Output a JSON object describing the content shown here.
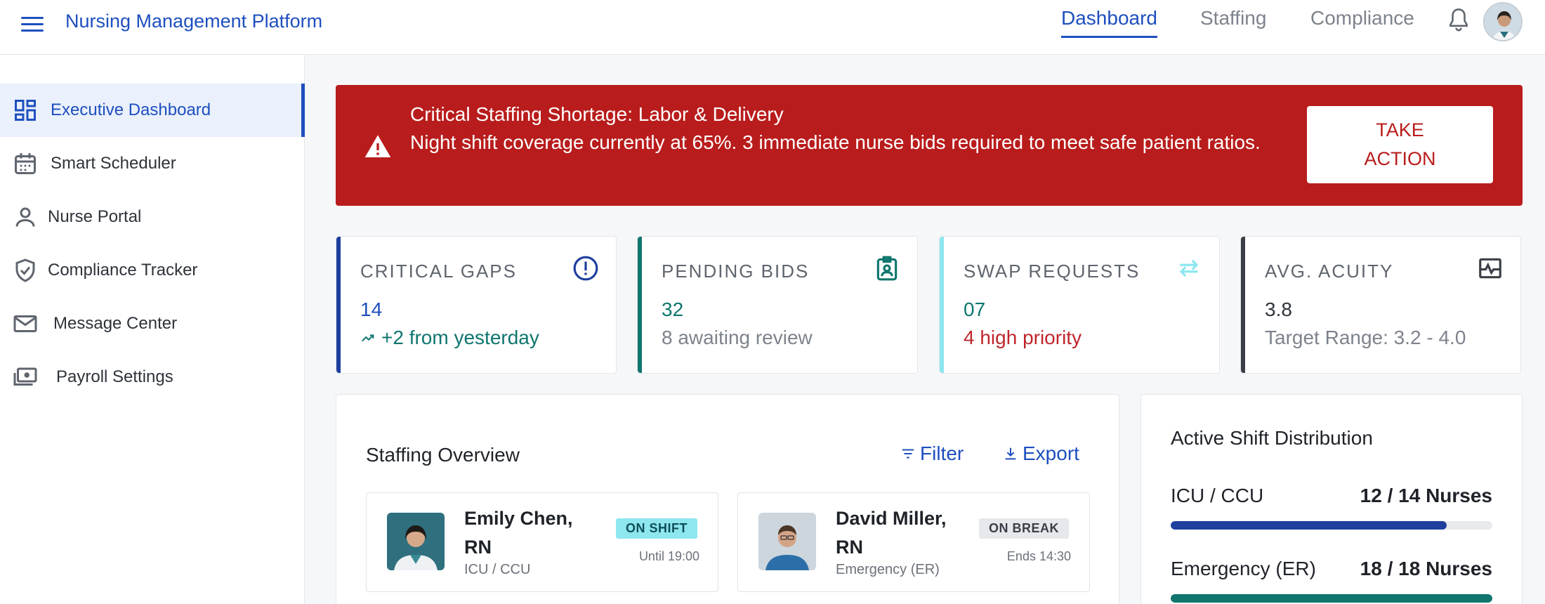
{
  "header": {
    "app_title": "Nursing Management Platform",
    "tabs": [
      {
        "label": "Dashboard",
        "active": true
      },
      {
        "label": "Staffing",
        "active": false
      },
      {
        "label": "Compliance",
        "active": false
      }
    ],
    "icons": [
      "menu-icon",
      "bell-icon",
      "avatar"
    ]
  },
  "sidebar": {
    "items": [
      {
        "label": "Executive Dashboard",
        "icon": "dashboard-icon",
        "active": true
      },
      {
        "label": "Smart Scheduler",
        "icon": "calendar-icon",
        "active": false
      },
      {
        "label": "Nurse Portal",
        "icon": "person-icon",
        "active": false
      },
      {
        "label": "Compliance Tracker",
        "icon": "shield-check-icon",
        "active": false
      },
      {
        "label": "Message Center",
        "icon": "mail-icon",
        "active": false
      },
      {
        "label": "Payroll Settings",
        "icon": "money-icon",
        "active": false
      }
    ]
  },
  "alert": {
    "title": "Critical Staffing Shortage: Labor & Delivery",
    "body": "Night shift coverage currently at 65%. 3 immediate nurse bids required to meet safe patient ratios.",
    "action_label_line1": "TAKE",
    "action_label_line2": "ACTION",
    "color": "#b91c1c"
  },
  "stats": [
    {
      "title": "CRITICAL GAPS",
      "value": "14",
      "sub": "+2 from yesterday",
      "icon": "alert-circle-icon",
      "accent": "#1e3f9e",
      "value_color": "#1e4fbf",
      "sub_color": "#0f766e"
    },
    {
      "title": "PENDING BIDS",
      "value": "32",
      "sub": "8 awaiting review",
      "icon": "badge-icon",
      "accent": "#0f766e",
      "value_color": "#0f766e",
      "sub_color": "#7d838c"
    },
    {
      "title": "SWAP REQUESTS",
      "value": "07",
      "sub": "4 high priority",
      "icon": "swap-icon",
      "accent": "#8ee6ef",
      "value_color": "#0f766e",
      "sub_color": "#c0262d"
    },
    {
      "title": "AVG. ACUITY",
      "value": "3.8",
      "sub": "Target Range: 3.2 - 4.0",
      "icon": "pulse-icon",
      "accent": "#3a3f47",
      "value_color": "#2e333a",
      "sub_color": "#7d838c"
    }
  ],
  "staffing": {
    "title": "Staffing Overview",
    "filter_label": "Filter",
    "export_label": "Export",
    "nurses": [
      {
        "name": "Emily Chen, RN",
        "dept": "ICU / CCU",
        "status": "ON SHIFT",
        "time": "Until 19:00"
      },
      {
        "name": "David Miller, RN",
        "dept": "Emergency (ER)",
        "status": "ON BREAK",
        "time": "Ends 14:30"
      }
    ]
  },
  "distribution": {
    "title": "Active Shift Distribution",
    "rows": [
      {
        "label": "ICU / CCU",
        "count": "12 / 14 Nurses",
        "fraction": 0.857,
        "color": "#1e3f9e"
      },
      {
        "label": "Emergency (ER)",
        "count": "18 / 18 Nurses",
        "fraction": 1.0,
        "color": "#0f766e"
      }
    ]
  }
}
